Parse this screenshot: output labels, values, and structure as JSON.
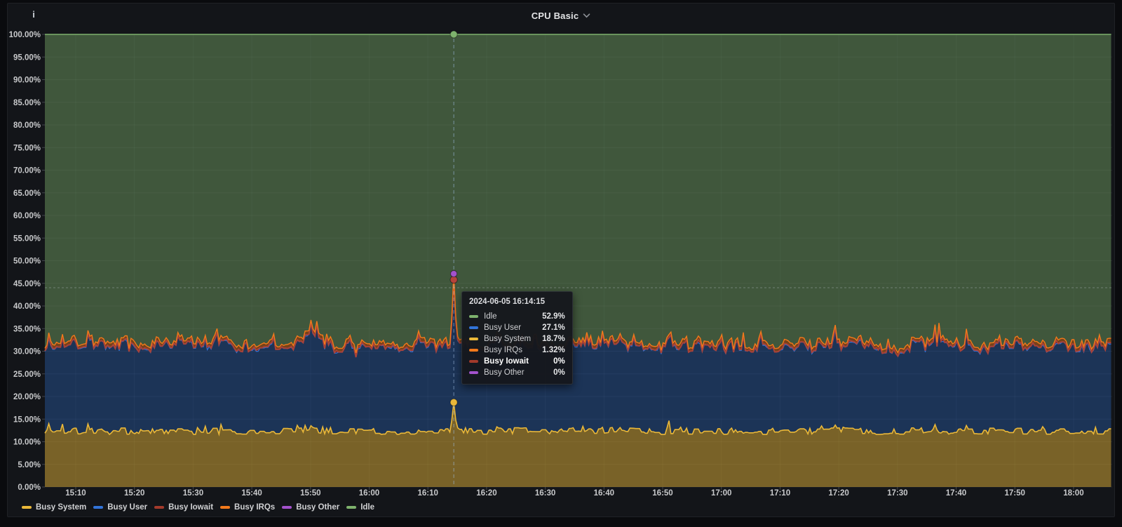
{
  "panel": {
    "title": "CPU Basic",
    "title_menu_icon": "chevron-down",
    "info_icon_glyph": "i"
  },
  "tooltip": {
    "timestamp": "2024-06-05 16:14:15",
    "rows": [
      {
        "label": "Idle",
        "value": "52.9%",
        "color": "#7EB26D",
        "bold": false
      },
      {
        "label": "Busy User",
        "value": "27.1%",
        "color": "#3274D9",
        "bold": false
      },
      {
        "label": "Busy System",
        "value": "18.7%",
        "color": "#EAB839",
        "bold": false
      },
      {
        "label": "Busy IRQs",
        "value": "1.32%",
        "color": "#F2791B",
        "bold": false
      },
      {
        "label": "Busy Iowait",
        "value": "0%",
        "color": "#A33A2B",
        "bold": true
      },
      {
        "label": "Busy Other",
        "value": "0%",
        "color": "#A352CC",
        "bold": false
      }
    ]
  },
  "legend": {
    "items": [
      {
        "label": "Busy System",
        "color": "#EAB839"
      },
      {
        "label": "Busy User",
        "color": "#3274D9"
      },
      {
        "label": "Busy Iowait",
        "color": "#A33A2B"
      },
      {
        "label": "Busy IRQs",
        "color": "#F2791B"
      },
      {
        "label": "Busy Other",
        "color": "#A352CC"
      },
      {
        "label": "Idle",
        "color": "#7EB26D"
      }
    ]
  },
  "colors": {
    "page_bg": "#0a0b0e",
    "panel_bg": "#131519",
    "grid": "rgba(204,212,222,0.07)",
    "tick_text": "#c8c9cb",
    "crosshair": "rgba(160,190,225,0.6)"
  },
  "chart_data": {
    "type": "area",
    "stacked": true,
    "title": "CPU Basic",
    "grid": true,
    "legend_position": "bottom",
    "x_axis": {
      "start": "15:05",
      "end": "18:07",
      "tick_interval_min": 10,
      "ticks": [
        "15:10",
        "15:20",
        "15:30",
        "15:40",
        "15:50",
        "16:00",
        "16:10",
        "16:20",
        "16:30",
        "16:40",
        "16:50",
        "17:00",
        "17:10",
        "17:20",
        "17:30",
        "17:40",
        "17:50",
        "18:00"
      ]
    },
    "y_axis": {
      "min": 0,
      "max": 100,
      "tick_step": 5,
      "unit": "percent",
      "ticks": [
        "0.00%",
        "5.00%",
        "10.00%",
        "15.00%",
        "20.00%",
        "25.00%",
        "30.00%",
        "35.00%",
        "40.00%",
        "45.00%",
        "50.00%",
        "55.00%",
        "60.00%",
        "65.00%",
        "70.00%",
        "75.00%",
        "80.00%",
        "85.00%",
        "90.00%",
        "95.00%",
        "100.00%"
      ]
    },
    "cursor": {
      "timestamp": "2024-06-05 16:14:15",
      "time": "16:14:15",
      "time_min": 974.25,
      "crosshair_y_percent": 44
    },
    "series": [
      {
        "name": "Busy System",
        "color": "#EAB839",
        "fill_opacity": 0.48,
        "stroke_width": 1.6,
        "baseline": 12.15,
        "noise": [
          -0.55,
          0.95
        ],
        "run": 3,
        "spike_p": 0.05,
        "spike_amp": [
          0.5,
          1.6
        ],
        "at_cursor": 18.7,
        "bumps": [
          [
            "15:50",
            1.4,
            0.9
          ],
          [
            "16:42",
            1.8,
            0.4
          ],
          [
            "17:36",
            1.3,
            0.5
          ]
        ]
      },
      {
        "name": "Busy User",
        "color": "#3274D9",
        "fill_opacity": 0.33,
        "stroke_width": 1.2,
        "baseline": 18.55,
        "noise": [
          -0.9,
          1.2
        ],
        "run": 3,
        "spike_p": 0.055,
        "spike_amp": [
          0.8,
          2.6
        ],
        "dip_p": 0.03,
        "dip_amp": [
          0.6,
          1.4
        ],
        "at_cursor": 27.1,
        "bumps": [
          [
            "15:50",
            1.4,
            2.3
          ],
          [
            "15:52",
            0.6,
            1.2
          ],
          [
            "15:48",
            0.7,
            1.0
          ],
          [
            "16:42",
            1.8,
            1.4
          ],
          [
            "17:36",
            1.3,
            1.6
          ]
        ]
      },
      {
        "name": "Busy Iowait",
        "color": "#A33A2B",
        "fill_opacity": 0.4,
        "stroke_width": 2,
        "baseline": 0.05,
        "noise": [
          -0.2,
          0.3
        ],
        "run": 2,
        "spike_p": 0.04,
        "spike_amp": [
          0.3,
          0.7
        ],
        "min": 0,
        "at_cursor": 0
      },
      {
        "name": "Busy IRQs",
        "color": "#F2791B",
        "fill_opacity": 0.45,
        "stroke_width": 1.4,
        "baseline": 0.55,
        "noise": [
          0,
          0.45
        ],
        "run": 4,
        "at_cursor": 1.32
      },
      {
        "name": "Busy Other",
        "color": "#A352CC",
        "fill_opacity": 0.4,
        "stroke_width": 1,
        "baseline": 0,
        "at_cursor": 0
      },
      {
        "name": "Idle",
        "color": "#7EB26D",
        "fill_opacity": 0.42,
        "stroke_width": 1.6,
        "remainder": true,
        "at_cursor": 52.9
      }
    ],
    "noise_model": {
      "seed": 1337,
      "step_min": 0.33333,
      "neighbor_blend": 0.4
    }
  }
}
